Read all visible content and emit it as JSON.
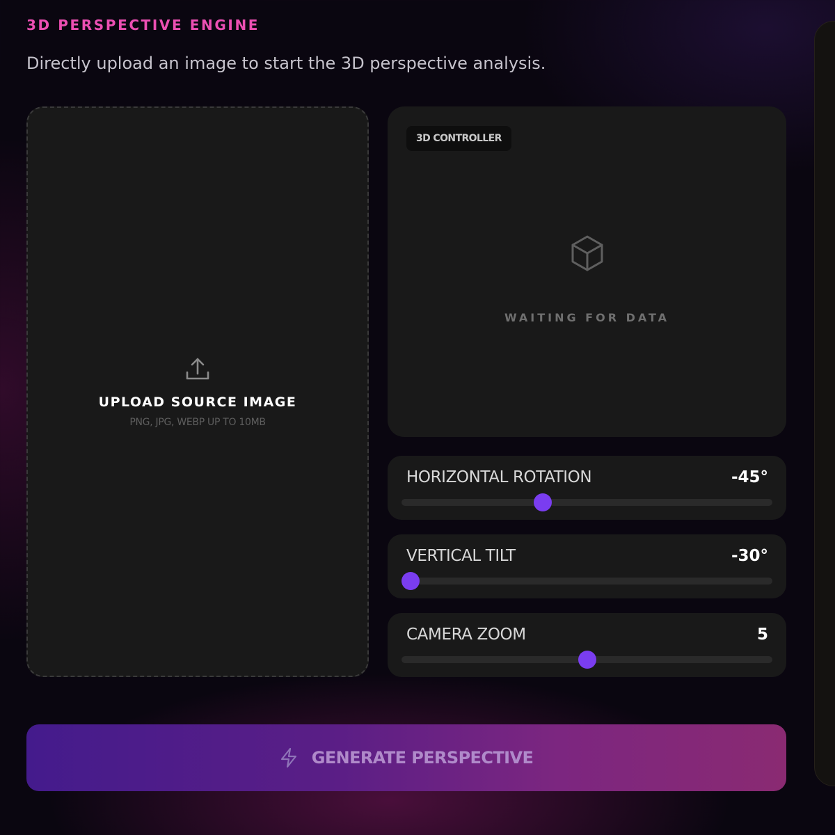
{
  "header": {
    "eyebrow": "3D PERSPECTIVE ENGINE",
    "subtitle": "Directly upload an image to start the 3D perspective analysis."
  },
  "upload": {
    "icon": "upload-icon",
    "title": "UPLOAD SOURCE IMAGE",
    "hint": "PNG, JPG, WEBP UP TO 10MB"
  },
  "controller": {
    "badge": "3D CONTROLLER",
    "icon": "cube-icon",
    "status": "WAITING FOR DATA"
  },
  "sliders": [
    {
      "label": "HORIZONTAL ROTATION",
      "value": "-45°",
      "fraction": 0.381
    },
    {
      "label": "VERTICAL TILT",
      "value": "-30°",
      "fraction": 0.025
    },
    {
      "label": "CAMERA ZOOM",
      "value": "5",
      "fraction": 0.5
    }
  ],
  "generate": {
    "icon": "bolt-icon",
    "label": "GENERATE PERSPECTIVE"
  },
  "colors": {
    "accent_pink": "#ec4fb3",
    "slider_thumb": "#7a3df0",
    "button_gradient_start": "#441b8c",
    "button_gradient_end": "#8a2a72"
  }
}
